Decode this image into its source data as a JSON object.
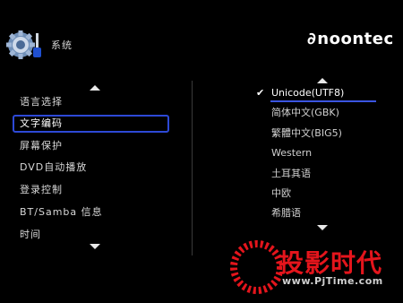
{
  "header": {
    "title": "系统",
    "icon": "settings-gear-icon",
    "brand": "noontec",
    "brand_mark": "∂"
  },
  "left_menu": {
    "items": [
      {
        "label": "语言选择"
      },
      {
        "label": "文字编码",
        "selected": true
      },
      {
        "label": "屏幕保护"
      },
      {
        "label": "DVD自动播放"
      },
      {
        "label": "登录控制"
      },
      {
        "label": "BT/Samba 信息"
      },
      {
        "label": "时间"
      }
    ]
  },
  "right_menu": {
    "check_mark": "✔",
    "items": [
      {
        "label": "Unicode(UTF8)",
        "selected": true
      },
      {
        "label": "简体中文(GBK)"
      },
      {
        "label": "繁體中文(BIG5)"
      },
      {
        "label": "Western"
      },
      {
        "label": "土耳其语"
      },
      {
        "label": "中欧"
      },
      {
        "label": "希腊语"
      }
    ]
  },
  "watermark": {
    "name": "投影时代",
    "url": "www.PjTime.com"
  },
  "colors": {
    "background": "#000000",
    "selection_border": "#2d49d6",
    "watermark_red": "#e4151c"
  }
}
